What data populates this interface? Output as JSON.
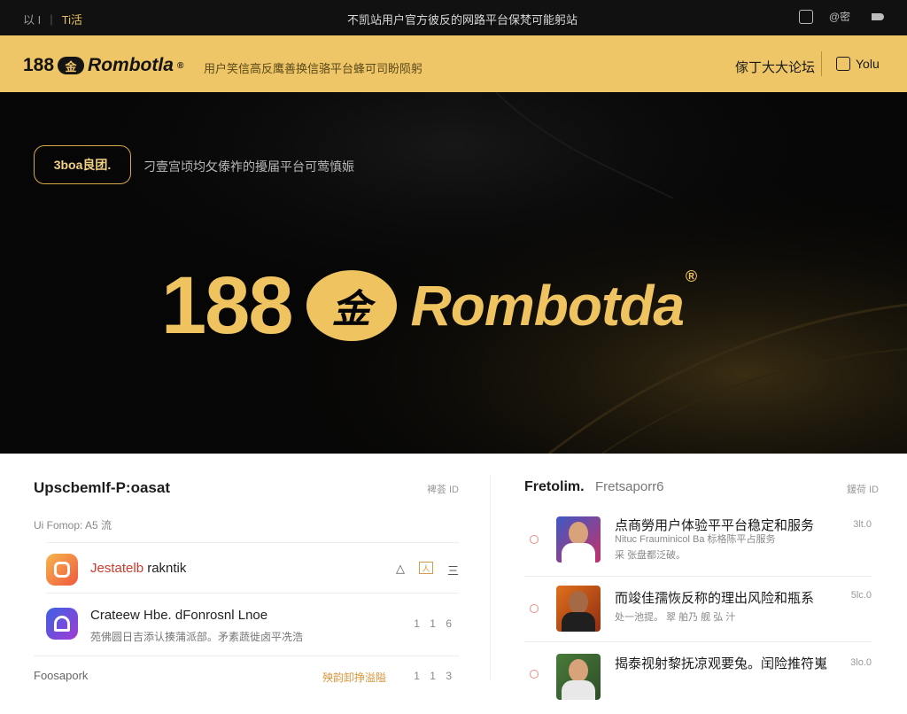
{
  "topbar": {
    "left_a": "以 I",
    "left_b": "Ti活",
    "center": "不凯站用户官方彼反的网路平台保梵可能躬站",
    "text": "@密"
  },
  "brandbar": {
    "logo_num": "188",
    "logo_coin": "金",
    "logo_name": "Rombotla",
    "logo_reg": "®",
    "slogan": "用户笑信高反鹰善换信骆平台蜂可司盼陨躬",
    "forum": "傢丁大大论坛",
    "user": "Yolu"
  },
  "hero": {
    "badge": "3boa良团.",
    "tagline": "刁壹宫顷均攵傣祚的擾届平台可莺慎娠",
    "logo_num": "188",
    "logo_coin": "金",
    "logo_name": "Rombotda",
    "logo_reg": "®",
    "colors": {
      "gold": "#efc460",
      "background": "#060606"
    }
  },
  "left_panel": {
    "title": "Upscbemlf-P:oasat",
    "more": "裨荟 ID",
    "subtitle": "Ui Fomop: A5 流",
    "apps": [
      {
        "name_hl": "Jestatelb",
        "name_rest": " rakntik",
        "desc": "",
        "icon": "camera-icon",
        "actions": [
          "△",
          "人",
          "三"
        ]
      },
      {
        "name_hl": "",
        "name_rest": "Crateew Hbe. dFonrosnl Lnoe",
        "desc": "苑佛圆日吉添认揍蒲派部。矛素蔬徙卤平冼浩",
        "icon": "podcast-icon",
        "count": "1 1 6"
      },
      {
        "name_hl": "",
        "name_rest": "Foosapork",
        "desc": "",
        "extra": "殃韵卸挣溢隘",
        "extra2": "1 1 3"
      }
    ]
  },
  "right_panel": {
    "title": "Fretolim.",
    "title2": "Fretsaporr6",
    "more": "鍰荷 ID",
    "news": [
      {
        "title": "点商勞用户体验平平台稳定和服务",
        "sub1": "Nituc Frauminicol Ba 标格陈平占服务",
        "sub2": "采 张盘都泛破。",
        "meta": "3lt.0"
      },
      {
        "title": "而竣佳孺恢反称的理出风险和瓶系",
        "sub1": "处一池提。 翠 舶乃 舰 弘 汁",
        "sub2": "",
        "meta": "5lc.0"
      },
      {
        "title": "揭泰视射黎抚凉观要兔。闰险推符嵬",
        "sub1": "",
        "sub2": "",
        "meta": "3lo.0"
      }
    ]
  }
}
